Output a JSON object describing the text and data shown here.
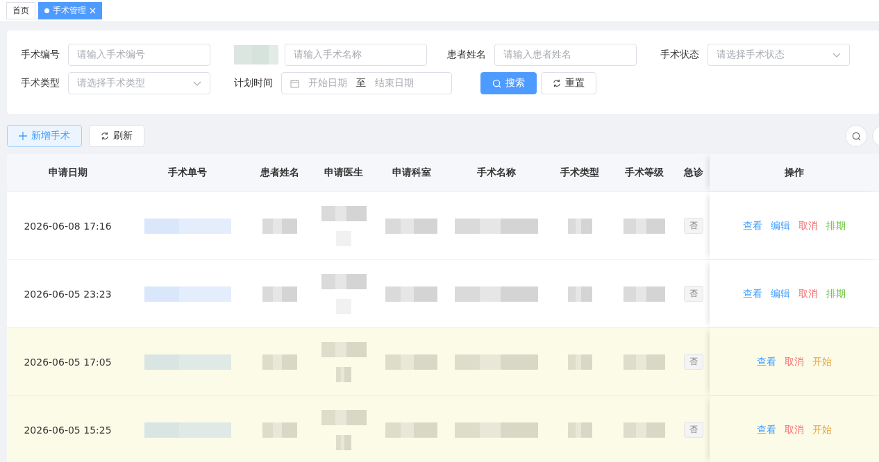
{
  "tabs": [
    {
      "label": "首页",
      "selected": false
    },
    {
      "label": "手术管理",
      "selected": true
    }
  ],
  "search_form": {
    "rows": [
      [
        {
          "kind": "input",
          "label": "手术编号",
          "placeholder": "请输入手术编号"
        },
        {
          "kind": "input",
          "label_redacted": true,
          "placeholder": "请输入手术名称"
        },
        {
          "kind": "input",
          "label": "患者姓名",
          "placeholder": "请输入患者姓名"
        },
        {
          "kind": "select",
          "label": "手术状态",
          "placeholder": "请选择手术状态"
        }
      ],
      [
        {
          "kind": "select",
          "label": "手术类型",
          "placeholder": "请选择手术类型"
        },
        {
          "kind": "daterange",
          "label": "计划时间",
          "start_placeholder": "开始日期",
          "separator": "至",
          "end_placeholder": "结束日期"
        },
        {
          "kind": "buttons",
          "buttons": [
            {
              "kind": "search",
              "label": "搜索"
            },
            {
              "kind": "reset",
              "label": "重置"
            }
          ]
        }
      ]
    ]
  },
  "toolbar": [
    {
      "kind": "add",
      "label": "新增手术"
    },
    {
      "kind": "refresh",
      "label": "刷新"
    }
  ],
  "table": {
    "columns": [
      "申请日期",
      "手术单号",
      "患者姓名",
      "申请医生",
      "申请科室",
      "手术名称",
      "手术类型",
      "手术等级",
      "急诊",
      "操作"
    ],
    "rows": [
      {
        "date": "2026-06-08 17:16",
        "highlighted": false,
        "urgent": "否",
        "actions": [
          {
            "label": "查看",
            "color": "#409eff"
          },
          {
            "label": "编辑",
            "color": "#409eff"
          },
          {
            "label": "取消",
            "color": "#f56c6c"
          },
          {
            "label": "排期",
            "color": "#67c23a"
          }
        ]
      },
      {
        "date": "2026-06-05 23:23",
        "highlighted": false,
        "urgent": "否",
        "actions": [
          {
            "label": "查看",
            "color": "#409eff"
          },
          {
            "label": "编辑",
            "color": "#409eff"
          },
          {
            "label": "取消",
            "color": "#f56c6c"
          },
          {
            "label": "排期",
            "color": "#67c23a"
          }
        ]
      },
      {
        "date": "2026-06-05 17:05",
        "highlighted": true,
        "urgent": "否",
        "actions": [
          {
            "label": "查看",
            "color": "#409eff"
          },
          {
            "label": "取消",
            "color": "#f56c6c"
          },
          {
            "label": "开始",
            "color": "#e6a23c"
          }
        ]
      },
      {
        "date": "2026-06-05 15:25",
        "highlighted": true,
        "urgent": "否",
        "actions": [
          {
            "label": "查看",
            "color": "#409eff"
          },
          {
            "label": "取消",
            "color": "#f56c6c"
          },
          {
            "label": "开始",
            "color": "#e6a23c"
          }
        ]
      }
    ]
  }
}
